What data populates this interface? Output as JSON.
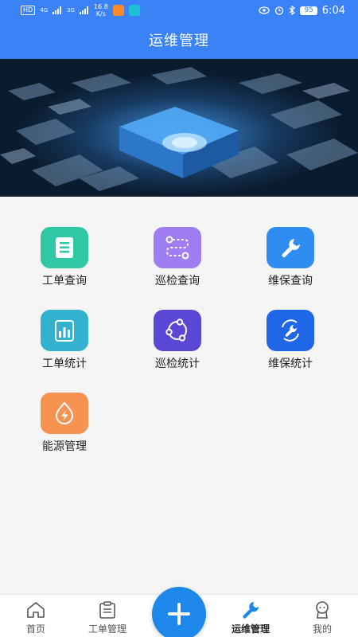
{
  "status_bar": {
    "network_label": "HD",
    "signal1": "4G",
    "signal2": "3G",
    "speed_value": "16.8",
    "speed_unit": "K/s",
    "battery": "95",
    "time": "6:04"
  },
  "header": {
    "title": "运维管理"
  },
  "banner": {
    "description_icon": "city-aerial-illustration"
  },
  "menu": [
    {
      "label": "工单查询",
      "icon": "document-list-icon",
      "color": "#2ec9a4"
    },
    {
      "label": "巡检查询",
      "icon": "route-path-icon",
      "color": "#a07ef2"
    },
    {
      "label": "维保查询",
      "icon": "wrench-icon",
      "color": "#2f8df2"
    },
    {
      "label": "工单统计",
      "icon": "bar-chart-icon",
      "color": "#33b2cf"
    },
    {
      "label": "巡检统计",
      "icon": "share-nodes-icon",
      "color": "#5b47d6"
    },
    {
      "label": "维保统计",
      "icon": "wrench-circle-icon",
      "color": "#1f67e6"
    },
    {
      "label": "能源管理",
      "icon": "energy-bolt-icon",
      "color": "#f79250"
    }
  ],
  "tabs": [
    {
      "label": "首页",
      "icon": "home-icon"
    },
    {
      "label": "工单管理",
      "icon": "clipboard-icon"
    },
    {
      "label": "",
      "icon": "plus-icon"
    },
    {
      "label": "运维管理",
      "icon": "wrench-icon"
    },
    {
      "label": "我的",
      "icon": "user-icon"
    }
  ],
  "colors": {
    "primary": "#3b82f6",
    "fab": "#1e88ea",
    "background": "#f5f5f5"
  }
}
